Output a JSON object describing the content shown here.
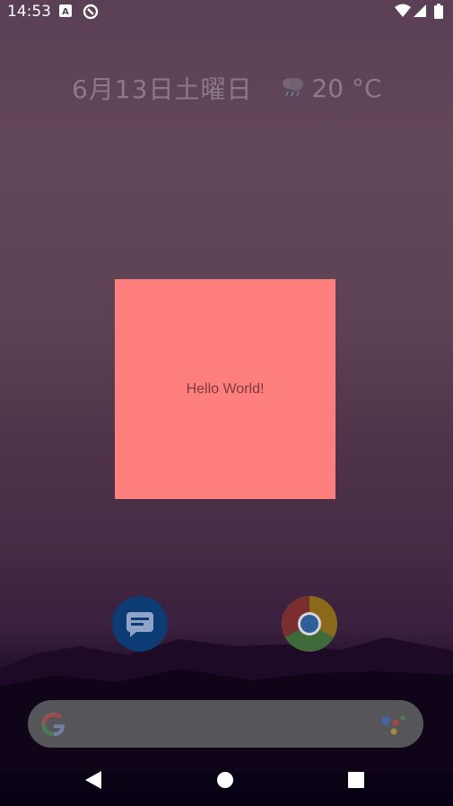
{
  "status_bar": {
    "time": "14:53",
    "icons": [
      "a-icon",
      "sync-icon",
      "wifi-icon",
      "signal-icon",
      "battery-icon"
    ]
  },
  "date_widget": {
    "date": "6月13日土曜日",
    "weather_icon": "rain-cloud-icon",
    "temperature": "20 °C"
  },
  "app_widget": {
    "text": "Hello World!",
    "color": "#ff7f7f"
  },
  "dock": {
    "apps": [
      "messages-icon",
      "chrome-icon"
    ]
  },
  "search_bar": {
    "icons": [
      "google-g-icon",
      "assistant-icon"
    ]
  },
  "nav_bar": {
    "buttons": [
      "back-button",
      "home-button",
      "recents-button"
    ]
  }
}
